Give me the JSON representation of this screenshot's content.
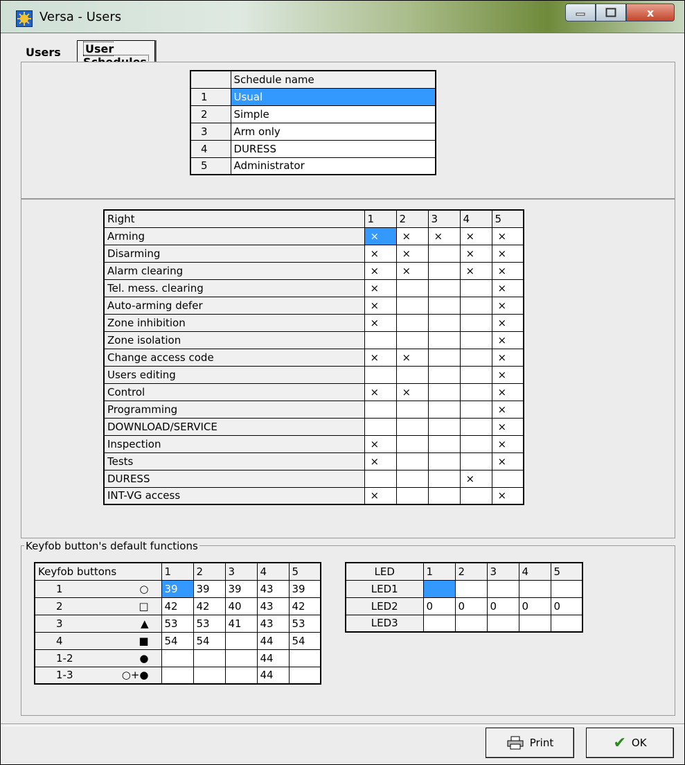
{
  "window": {
    "title": "Versa - Users",
    "close_label": "x"
  },
  "tabs": [
    {
      "label": "Users"
    },
    {
      "label": "User Schedules"
    }
  ],
  "schedules": {
    "header": "Schedule name",
    "rows": [
      {
        "num": "1",
        "name": "Usual"
      },
      {
        "num": "2",
        "name": "Simple"
      },
      {
        "num": "3",
        "name": "Arm only"
      },
      {
        "num": "4",
        "name": "DURESS"
      },
      {
        "num": "5",
        "name": "Administrator"
      }
    ]
  },
  "rights": {
    "header": "Right",
    "columns": [
      "1",
      "2",
      "3",
      "4",
      "5"
    ],
    "mark": "×",
    "rows": [
      {
        "name": "Arming",
        "c": [
          1,
          1,
          1,
          1,
          1
        ]
      },
      {
        "name": "Disarming",
        "c": [
          1,
          1,
          0,
          1,
          1
        ]
      },
      {
        "name": "Alarm clearing",
        "c": [
          1,
          1,
          0,
          1,
          1
        ]
      },
      {
        "name": "Tel. mess. clearing",
        "c": [
          1,
          0,
          0,
          0,
          1
        ]
      },
      {
        "name": "Auto-arming defer",
        "c": [
          1,
          0,
          0,
          0,
          1
        ]
      },
      {
        "name": "Zone inhibition",
        "c": [
          1,
          0,
          0,
          0,
          1
        ]
      },
      {
        "name": "Zone isolation",
        "c": [
          0,
          0,
          0,
          0,
          1
        ]
      },
      {
        "name": "Change access code",
        "c": [
          1,
          1,
          0,
          0,
          1
        ]
      },
      {
        "name": "Users editing",
        "c": [
          0,
          0,
          0,
          0,
          1
        ]
      },
      {
        "name": "Control",
        "c": [
          1,
          1,
          0,
          0,
          1
        ]
      },
      {
        "name": "Programming",
        "c": [
          0,
          0,
          0,
          0,
          1
        ]
      },
      {
        "name": "DOWNLOAD/SERVICE",
        "c": [
          0,
          0,
          0,
          0,
          1
        ]
      },
      {
        "name": "Inspection",
        "c": [
          1,
          0,
          0,
          0,
          1
        ]
      },
      {
        "name": "Tests",
        "c": [
          1,
          0,
          0,
          0,
          1
        ]
      },
      {
        "name": "DURESS",
        "c": [
          0,
          0,
          0,
          1,
          0
        ]
      },
      {
        "name": "INT-VG access",
        "c": [
          1,
          0,
          0,
          0,
          1
        ]
      }
    ]
  },
  "keyfob": {
    "group_label": "Keyfob button's default functions",
    "header": "Keyfob buttons",
    "columns": [
      "1",
      "2",
      "3",
      "4",
      "5"
    ],
    "rows": [
      {
        "num": "1",
        "symbol": "○",
        "v": [
          "39",
          "39",
          "39",
          "43",
          "39"
        ]
      },
      {
        "num": "2",
        "symbol": "□",
        "v": [
          "42",
          "42",
          "40",
          "43",
          "42"
        ]
      },
      {
        "num": "3",
        "symbol": "▲",
        "v": [
          "53",
          "53",
          "41",
          "43",
          "53"
        ]
      },
      {
        "num": "4",
        "symbol": "■",
        "v": [
          "54",
          "54",
          "",
          "44",
          "54"
        ]
      },
      {
        "num": "1-2",
        "symbol": "●",
        "v": [
          "",
          "",
          "",
          "44",
          ""
        ]
      },
      {
        "num": "1-3",
        "symbol": "○+●",
        "v": [
          "",
          "",
          "",
          "44",
          ""
        ]
      }
    ]
  },
  "led": {
    "header": "LED",
    "columns": [
      "1",
      "2",
      "3",
      "4",
      "5"
    ],
    "rows": [
      {
        "name": "LED1",
        "v": [
          "",
          "",
          "",
          "",
          ""
        ]
      },
      {
        "name": "LED2",
        "v": [
          "0",
          "0",
          "0",
          "0",
          "0"
        ]
      },
      {
        "name": "LED3",
        "v": [
          "",
          "",
          "",
          "",
          ""
        ]
      }
    ]
  },
  "buttons": {
    "print": "Print",
    "ok": "OK"
  },
  "colors": {
    "selection": "#3399ff"
  }
}
